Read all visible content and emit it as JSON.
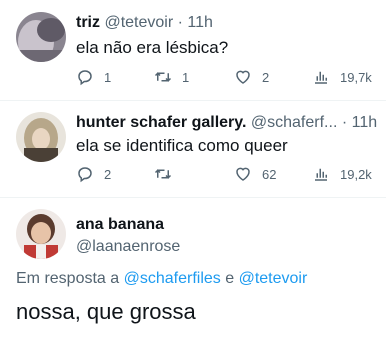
{
  "tweets": [
    {
      "name": "triz",
      "handle": "@tetevoir",
      "sep": "·",
      "time": "11h",
      "text": "ela não era lésbica?",
      "replies": "1",
      "retweets": "1",
      "likes": "2",
      "views": "19,7k"
    },
    {
      "name": "hunter schafer gallery.",
      "handle": "@schaferf...",
      "sep": "·",
      "time": "11h",
      "text": "ela se identifica como queer",
      "replies": "2",
      "retweets": "",
      "likes": "62",
      "views": "19,2k"
    }
  ],
  "main": {
    "name": "ana banana",
    "handle": "@laanaenrose",
    "reply_prefix": "Em resposta a",
    "mention_1": "@schaferfiles",
    "conjunction": "e",
    "mention_2": "@tetevoir",
    "text": "nossa, que grossa"
  },
  "colors": {
    "text": "#0f1419",
    "muted": "#536471",
    "link": "#1d9bf0"
  },
  "icons": [
    "reply-icon",
    "retweet-icon",
    "like-icon",
    "views-icon"
  ]
}
